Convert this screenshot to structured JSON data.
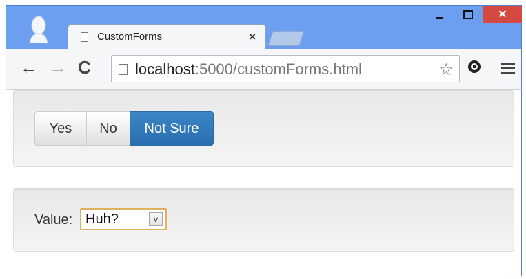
{
  "window": {
    "controls": {
      "minimize_icon": "minimize-icon",
      "maximize_icon": "maximize-icon",
      "close_label": "✕"
    }
  },
  "tab": {
    "title": "CustomForms",
    "close_label": "×"
  },
  "toolbar": {
    "back_label": "←",
    "forward_label": "→",
    "reload_label": "C",
    "url_host": "localhost",
    "url_rest": ":5000/customForms.html",
    "star_label": "☆"
  },
  "content": {
    "buttons": [
      {
        "label": "Yes",
        "active": false
      },
      {
        "label": "No",
        "active": false
      },
      {
        "label": "Not Sure",
        "active": true
      }
    ],
    "value_label": "Value:",
    "select_value": "Huh?",
    "select_arrow": "v"
  },
  "colors": {
    "frame": "#6c9ff0",
    "close_button": "#d44a40",
    "active_button": "#2a6ead",
    "select_focus": "#e2b15d"
  }
}
